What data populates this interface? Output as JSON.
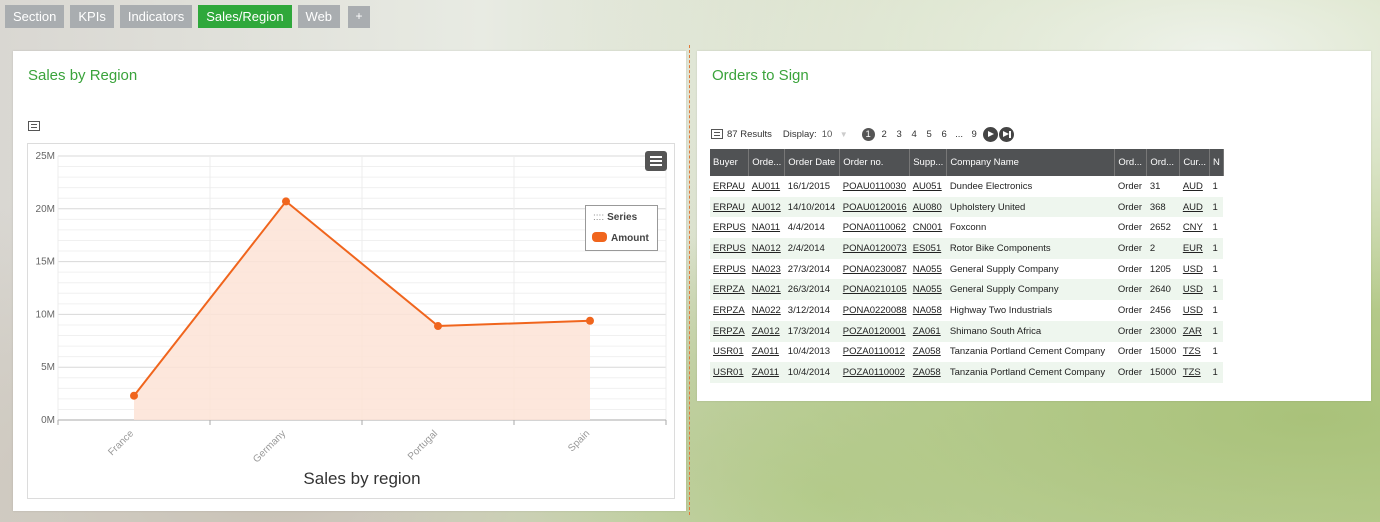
{
  "tabs": [
    {
      "label": "Section"
    },
    {
      "label": "KPIs"
    },
    {
      "label": "Indicators"
    },
    {
      "label": "Sales/Region",
      "active": true
    },
    {
      "label": "Web"
    },
    {
      "label": "+"
    }
  ],
  "left_panel": {
    "title": "Sales by Region"
  },
  "right_panel": {
    "title": "Orders to Sign"
  },
  "chart_data": {
    "type": "area",
    "title": "Sales by region",
    "categories": [
      "France",
      "Germany",
      "Portugal",
      "Spain"
    ],
    "series": [
      {
        "name": "Amount",
        "values": [
          2.3,
          20.7,
          8.9,
          9.4
        ]
      }
    ],
    "ylim": [
      0,
      25
    ],
    "yticks": [
      "0M",
      "5M",
      "10M",
      "15M",
      "20M",
      "25M"
    ],
    "legend": {
      "title": "Series",
      "position": "top-right"
    },
    "grid": true,
    "colors": {
      "line": "#f0651d",
      "fill": "#fde3d6"
    }
  },
  "orders": {
    "results_label": "87 Results",
    "display_label": "Display:",
    "display_value": "10",
    "pages": [
      "1",
      "2",
      "3",
      "4",
      "5",
      "6",
      "...",
      "9"
    ],
    "current_page": "1",
    "columns": [
      "Buyer",
      "Orde...",
      "Order Date",
      "Order no.",
      "Supp...",
      "Company Name",
      "Ord...",
      "Ord...",
      "Cur...",
      "N"
    ],
    "rows": [
      [
        "ERPAU",
        "AU011",
        "16/1/2015",
        "POAU0110030",
        "AU051",
        "Dundee Electronics",
        "Order",
        "31",
        "AUD",
        "1"
      ],
      [
        "ERPAU",
        "AU012",
        "14/10/2014",
        "POAU0120016",
        "AU080",
        "Upholstery United",
        "Order",
        "368",
        "AUD",
        "1"
      ],
      [
        "ERPUS",
        "NA011",
        "4/4/2014",
        "PONA0110062",
        "CN001",
        "Foxconn",
        "Order",
        "2652",
        "CNY",
        "1"
      ],
      [
        "ERPUS",
        "NA012",
        "2/4/2014",
        "PONA0120073",
        "ES051",
        "Rotor Bike Components",
        "Order",
        "2",
        "EUR",
        "1"
      ],
      [
        "ERPUS",
        "NA023",
        "27/3/2014",
        "PONA0230087",
        "NA055",
        "General Supply Company",
        "Order",
        "1205",
        "USD",
        "1"
      ],
      [
        "ERPZA",
        "NA021",
        "26/3/2014",
        "PONA0210105",
        "NA055",
        "General Supply Company",
        "Order",
        "2640",
        "USD",
        "1"
      ],
      [
        "ERPZA",
        "NA022",
        "3/12/2014",
        "PONA0220088",
        "NA058",
        "Highway Two Industrials",
        "Order",
        "2456",
        "USD",
        "1"
      ],
      [
        "ERPZA",
        "ZA012",
        "17/3/2014",
        "POZA0120001",
        "ZA061",
        "Shimano South Africa",
        "Order",
        "23000",
        "ZAR",
        "1"
      ],
      [
        "USR01",
        "ZA011",
        "10/4/2013",
        "POZA0110012",
        "ZA058",
        "Tanzania Portland Cement Company",
        "Order",
        "15000",
        "TZS",
        "1"
      ],
      [
        "USR01",
        "ZA011",
        "10/4/2014",
        "POZA0110002",
        "ZA058",
        "Tanzania Portland Cement Company",
        "Order",
        "15000",
        "TZS",
        "1"
      ]
    ]
  }
}
